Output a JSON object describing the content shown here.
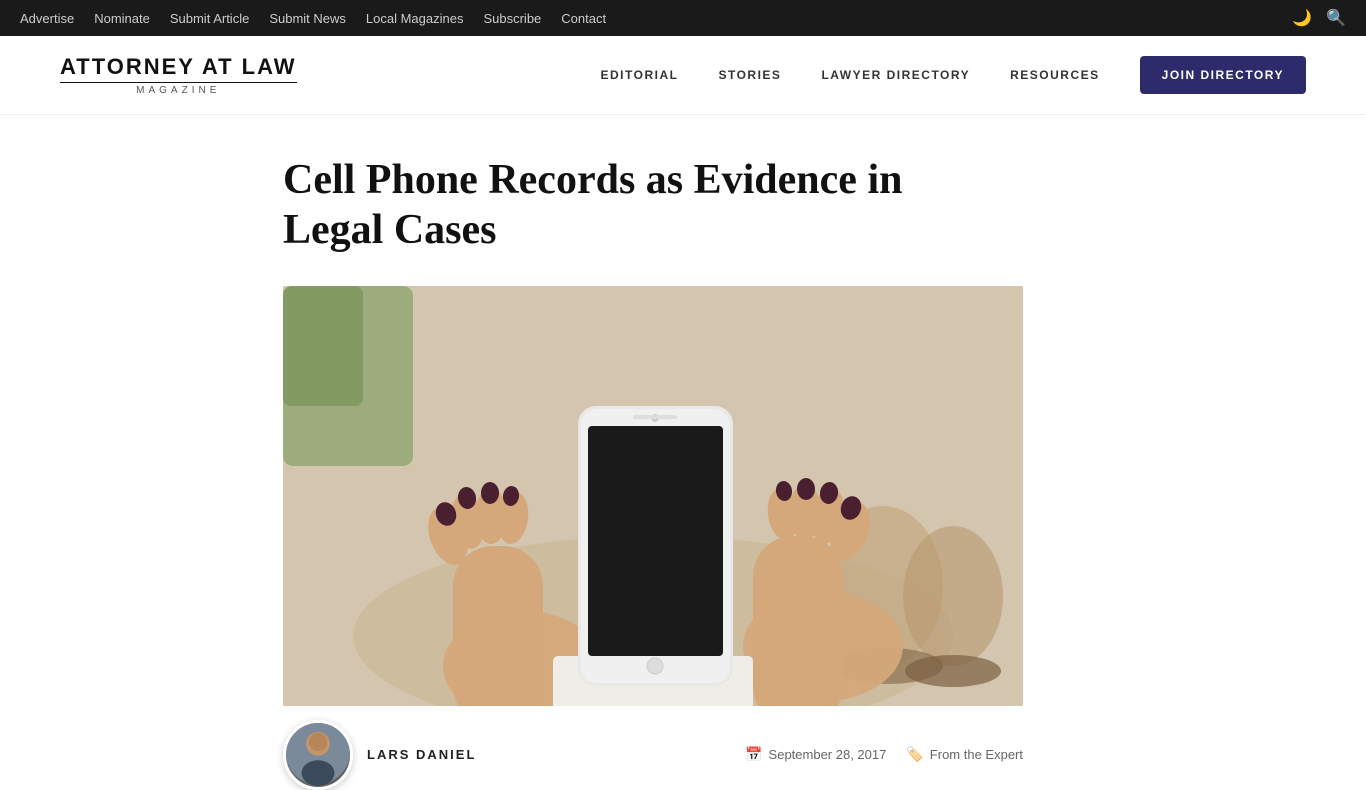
{
  "topbar": {
    "links": [
      {
        "label": "Advertise",
        "href": "#"
      },
      {
        "label": "Nominate",
        "href": "#"
      },
      {
        "label": "Submit Article",
        "href": "#"
      },
      {
        "label": "Submit News",
        "href": "#"
      },
      {
        "label": "Local Magazines",
        "href": "#"
      },
      {
        "label": "Subscribe",
        "href": "#"
      },
      {
        "label": "Contact",
        "href": "#"
      }
    ],
    "icons": [
      "moon-icon",
      "search-icon"
    ]
  },
  "header": {
    "logo": {
      "title": "ATTORNEY AT LAW",
      "subtitle": "MAGAZINE"
    },
    "nav": [
      {
        "label": "EDITORIAL",
        "href": "#"
      },
      {
        "label": "STORIES",
        "href": "#"
      },
      {
        "label": "LAWYER DIRECTORY",
        "href": "#"
      },
      {
        "label": "RESOURCES",
        "href": "#"
      }
    ],
    "join_button": "JOIN DIRECTORY"
  },
  "article": {
    "title": "Cell Phone Records as Evidence in Legal Cases",
    "author": {
      "name": "LARS DANIEL",
      "avatar_alt": "Lars Daniel headshot"
    },
    "date": "September 28, 2017",
    "category": "From the Expert"
  }
}
